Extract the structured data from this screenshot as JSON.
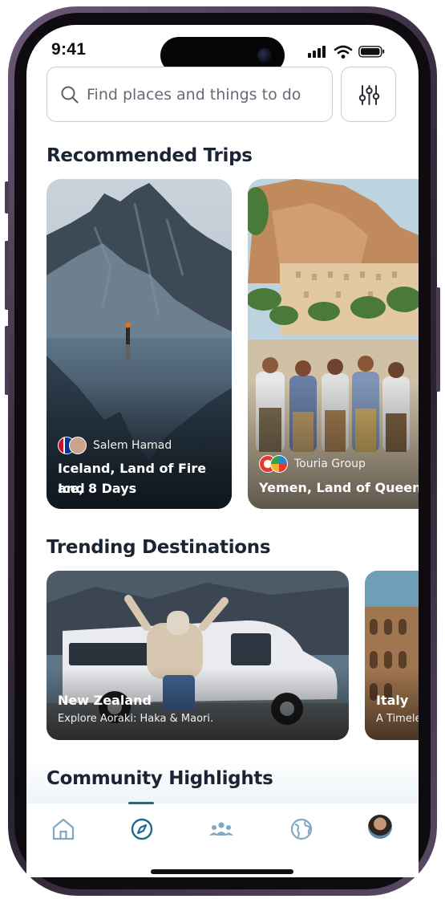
{
  "status_bar": {
    "time": "9:41"
  },
  "search": {
    "placeholder": "Find places and things to do"
  },
  "sections": {
    "recommended": "Recommended Trips",
    "trending": "Trending Destinations",
    "community": "Community Highlights"
  },
  "trips": [
    {
      "host": "Salem Hamad",
      "title_line1": "Iceland, Land of Fire and",
      "title_line2": "Ice, 8 Days"
    },
    {
      "host": "Touria Group",
      "title_line1": "Yemen, Land of Queens",
      "title_line2": ""
    }
  ],
  "destinations": [
    {
      "name": "New Zealand",
      "subtitle": "Explore Aoraki: Haka & Maori."
    },
    {
      "name": "Italy",
      "subtitle": "A Timele"
    }
  ],
  "nav": {
    "items": [
      "home-icon",
      "compass-icon",
      "community-icon",
      "globe-icon",
      "profile-avatar"
    ],
    "active": "compass-icon"
  },
  "colors": {
    "accent": "#1e6a8f",
    "nav_icon": "#7fa9c2",
    "title_text": "#1b2433",
    "search_border": "#c9ced6"
  }
}
